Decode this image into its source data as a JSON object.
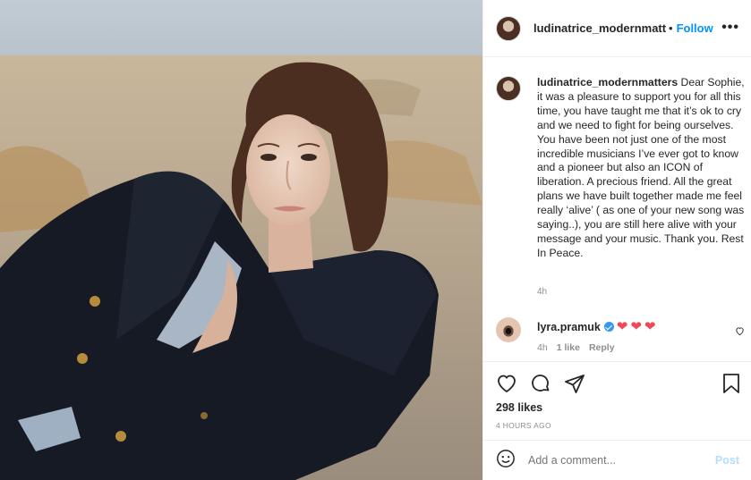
{
  "post": {
    "author": "ludinatrice_modernmatters",
    "follow_label": "Follow",
    "separator": "•",
    "more_label": "•••"
  },
  "caption": {
    "username": "ludinatrice_modernmatters",
    "text": "Dear Sophie, it was a pleasure to support you for all this time, you have taught me that it’s ok to cry and we need to fight for being ourselves. You have been not just one of the most incredible musicians I’ve ever got to know and a pioneer but also an ICON of liberation. A precious friend. All the great plans we have built together made me feel really ‘alive’ ( as one of your new song was saying..), you are still here alive with your message and your music. Thank you. Rest In Peace.",
    "time": "4h"
  },
  "reply": {
    "username": "lyra.pramuk",
    "hearts": [
      "❤",
      "❤",
      "❤"
    ],
    "time": "4h",
    "likes": "1 like",
    "reply_label": "Reply"
  },
  "actions": {
    "likes": "298 likes",
    "ago": "4 HOURS AGO"
  },
  "add_comment": {
    "placeholder": "Add a comment...",
    "post_label": "Post"
  },
  "colors": {
    "accent": "#0095f6",
    "heart": "#ed4956",
    "muted": "#8e8e8e",
    "post_disabled": "#b2dffc"
  }
}
